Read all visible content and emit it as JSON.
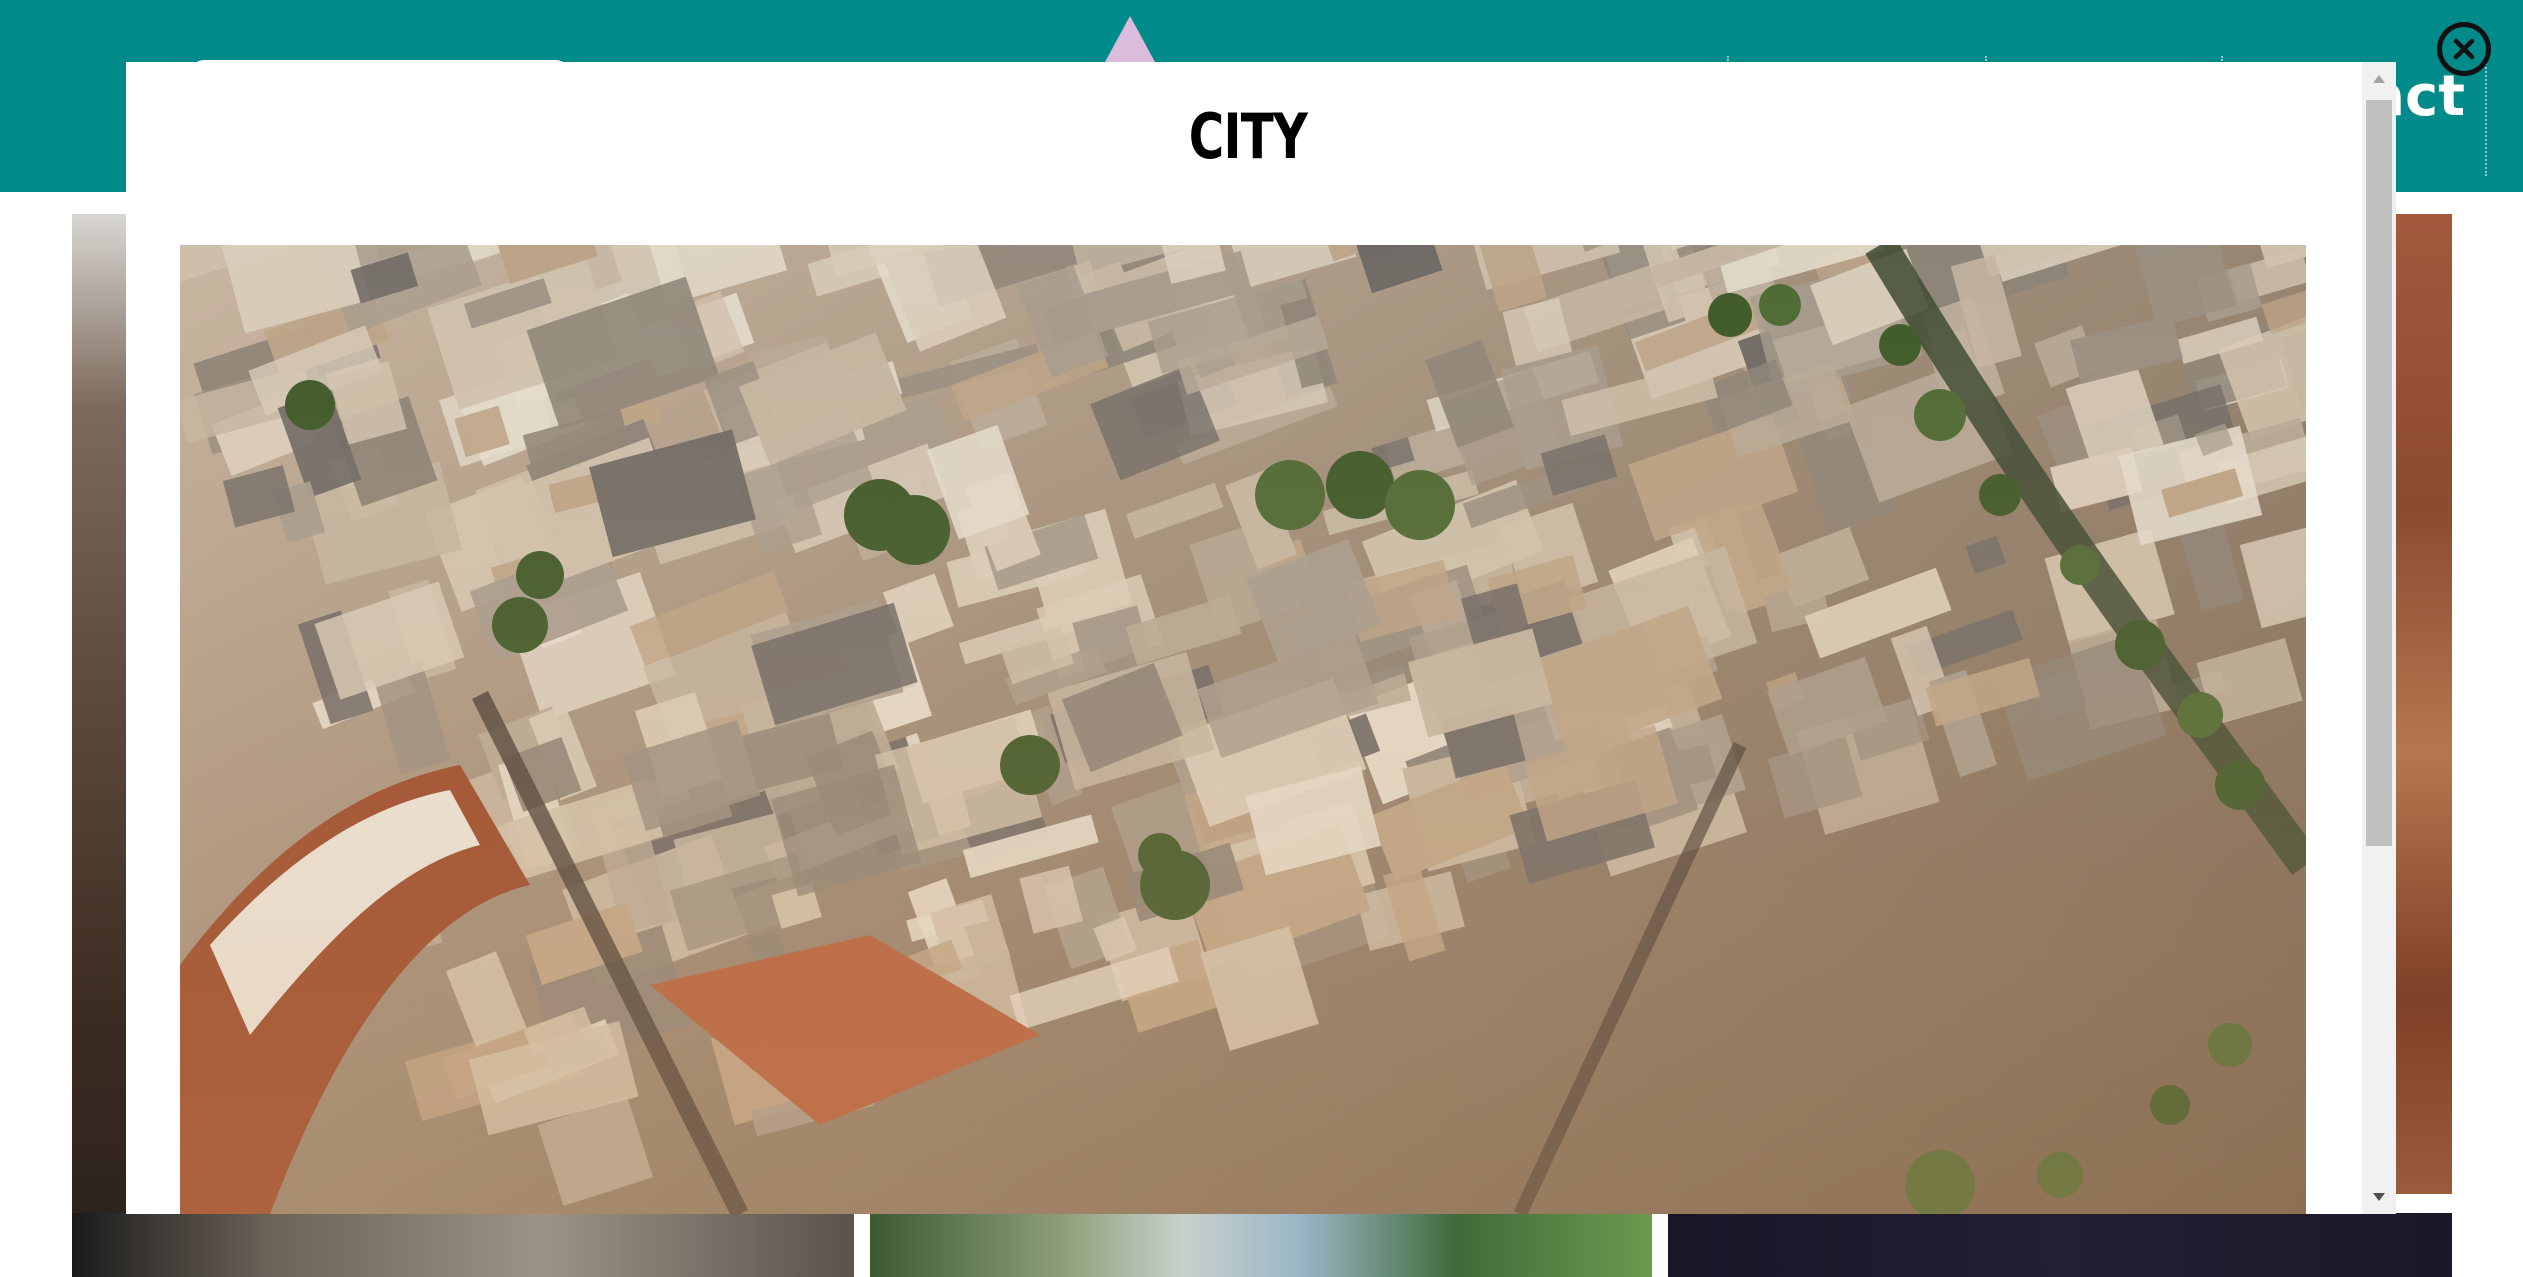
{
  "header": {
    "nav_contact_label": "Contact",
    "close_icon": "close-icon"
  },
  "modal": {
    "title": "CITY",
    "image_subject": "aerial-city-photo"
  },
  "colors": {
    "header_background": "#008a8a",
    "accent_triangle": "#dcbcdc",
    "modal_background": "#ffffff",
    "scrollbar_track": "#f1f1f1",
    "scrollbar_thumb": "#c1c1c1"
  },
  "scrollbar": {
    "up_icon": "arrow-up-icon",
    "down_icon": "arrow-down-icon",
    "scroll_position": 0.0
  }
}
